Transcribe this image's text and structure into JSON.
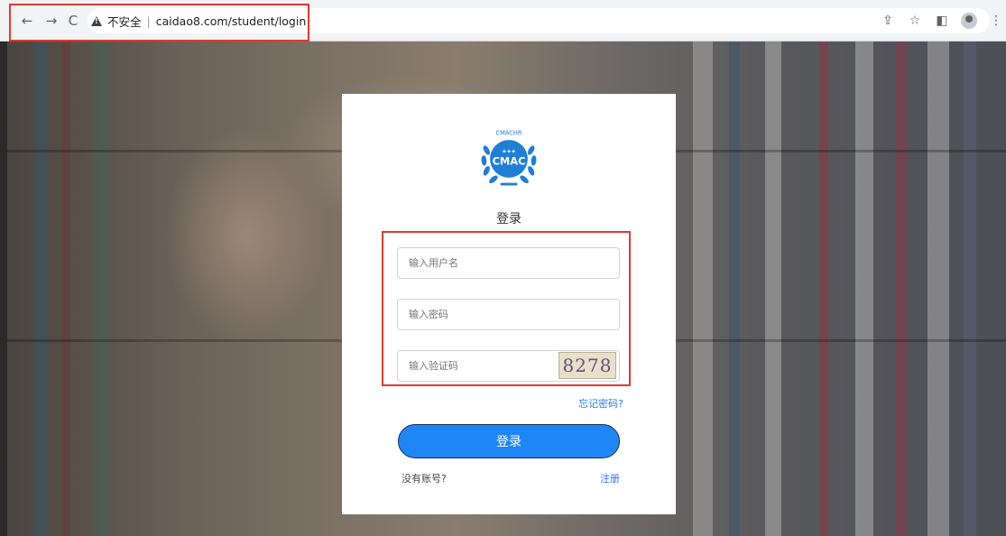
{
  "browser": {
    "security_label": "不安全",
    "url_host": "caidao8.com",
    "url_path": "/student/login"
  },
  "login": {
    "logo_text": "CMAC",
    "logo_arc_text": "CMACHR",
    "title": "登录",
    "username_placeholder": "输入用户名",
    "password_placeholder": "输入密码",
    "captcha_placeholder": "输入验证码",
    "captcha_text": "8278",
    "forgot_password": "忘记密码?",
    "submit_label": "登录",
    "no_account": "没有账号?",
    "register": "注册"
  },
  "colors": {
    "accent": "#1f86f5",
    "link": "#2b7bf0",
    "highlight": "#e03a2f"
  }
}
